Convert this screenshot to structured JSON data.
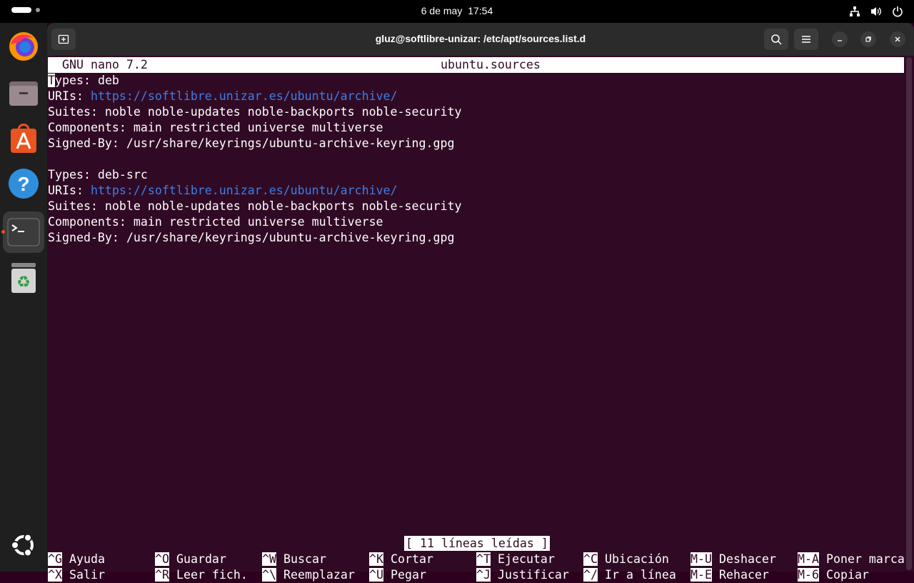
{
  "topbar": {
    "date": "6 de may",
    "time": "17:54"
  },
  "dock": {
    "items": [
      {
        "name": "firefox"
      },
      {
        "name": "files"
      },
      {
        "name": "app-center"
      },
      {
        "name": "help"
      },
      {
        "name": "terminal",
        "active": true
      },
      {
        "name": "trash"
      },
      {
        "name": "show-apps"
      }
    ]
  },
  "window": {
    "title": "gluz@softlibre-unizar: /etc/apt/sources.list.d"
  },
  "nano": {
    "version": "GNU nano 7.2",
    "filename": "ubuntu.sources",
    "cursor_char": "T",
    "lines": [
      {
        "key": "ypes: ",
        "value": "deb"
      },
      {
        "key": "URIs: ",
        "value": "https://softlibre.unizar.es/ubuntu/archive/"
      },
      {
        "text": "Suites: noble noble-updates noble-backports noble-security"
      },
      {
        "text": "Components: main restricted universe multiverse"
      },
      {
        "text": "Signed-By: /usr/share/keyrings/ubuntu-archive-keyring.gpg"
      },
      {
        "text": ""
      },
      {
        "text": "Types: deb-src"
      },
      {
        "key": "URIs: ",
        "value": "https://softlibre.unizar.es/ubuntu/archive/"
      },
      {
        "text": "Suites: noble noble-updates noble-backports noble-security"
      },
      {
        "text": "Components: main restricted universe multiverse"
      },
      {
        "text": "Signed-By: /usr/share/keyrings/ubuntu-archive-keyring.gpg"
      }
    ],
    "status": "[ 11 líneas leídas ]",
    "shortcuts": [
      [
        {
          "key": "^G",
          "label": "Ayuda"
        },
        {
          "key": "^O",
          "label": "Guardar"
        },
        {
          "key": "^W",
          "label": "Buscar"
        },
        {
          "key": "^K",
          "label": "Cortar"
        },
        {
          "key": "^T",
          "label": "Ejecutar"
        },
        {
          "key": "^C",
          "label": "Ubicación"
        },
        {
          "key": "M-U",
          "label": "Deshacer"
        },
        {
          "key": "M-A",
          "label": "Poner marca"
        }
      ],
      [
        {
          "key": "^X",
          "label": "Salir"
        },
        {
          "key": "^R",
          "label": "Leer fich."
        },
        {
          "key": "^\\",
          "label": "Reemplazar"
        },
        {
          "key": "^U",
          "label": "Pegar"
        },
        {
          "key": "^J",
          "label": "Justificar"
        },
        {
          "key": "^/",
          "label": "Ir a línea"
        },
        {
          "key": "M-E",
          "label": "Rehacer"
        },
        {
          "key": "M-6",
          "label": "Copiar"
        }
      ]
    ]
  },
  "colors": {
    "terminal_bg": "#300a24",
    "link": "#3d7ee6",
    "accent": "#e95420"
  }
}
